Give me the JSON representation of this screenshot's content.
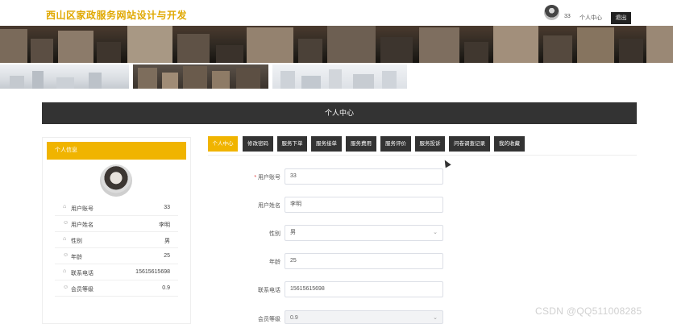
{
  "header": {
    "site_title": "西山区家政服务网站设计与开发",
    "user_number": "33",
    "personal_center_link": "个人中心",
    "logout_label": "退出"
  },
  "section": {
    "title": "个人中心"
  },
  "sidebar": {
    "header": "个人信息",
    "rows": [
      {
        "icon": "home-icon",
        "label": "用户账号",
        "value": "33"
      },
      {
        "icon": "user-icon",
        "label": "用户姓名",
        "value": "李明"
      },
      {
        "icon": "home-icon",
        "label": "性别",
        "value": "男"
      },
      {
        "icon": "user-icon",
        "label": "年龄",
        "value": "25"
      },
      {
        "icon": "home-icon",
        "label": "联系电话",
        "value": "15615615698"
      },
      {
        "icon": "user-icon",
        "label": "会员等级",
        "value": "0.9"
      }
    ]
  },
  "tabs": [
    {
      "label": "个人中心",
      "active": true
    },
    {
      "label": "修改密码",
      "active": false
    },
    {
      "label": "服务下单",
      "active": false
    },
    {
      "label": "服务接单",
      "active": false
    },
    {
      "label": "服务费用",
      "active": false
    },
    {
      "label": "服务评价",
      "active": false
    },
    {
      "label": "服务投诉",
      "active": false
    },
    {
      "label": "问卷调查记录",
      "active": false
    },
    {
      "label": "我的收藏",
      "active": false
    }
  ],
  "form": {
    "required_mark": "*",
    "fields": [
      {
        "label": "用户账号",
        "value": "33",
        "type": "text"
      },
      {
        "label": "用户姓名",
        "value": "李明",
        "type": "text"
      },
      {
        "label": "性别",
        "value": "男",
        "type": "select"
      },
      {
        "label": "年龄",
        "value": "25",
        "type": "text"
      },
      {
        "label": "联系电话",
        "value": "15615615698",
        "type": "text"
      },
      {
        "label": "会员等级",
        "value": "0.9",
        "type": "select-disabled"
      }
    ]
  },
  "watermark": "CSDN @QQ511008285",
  "colors": {
    "accent": "#f0b400",
    "dark": "#333333",
    "title": "#e0a800"
  }
}
